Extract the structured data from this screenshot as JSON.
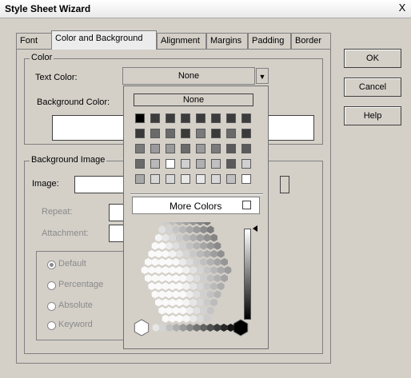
{
  "window": {
    "title": "Style Sheet Wizard",
    "close_glyph": "X"
  },
  "tabs": [
    {
      "label": "Font"
    },
    {
      "label": "Color and Background"
    },
    {
      "label": "Alignment"
    },
    {
      "label": "Margins"
    },
    {
      "label": "Padding"
    },
    {
      "label": "Border"
    }
  ],
  "buttons": {
    "ok": "OK",
    "cancel": "Cancel",
    "help": "Help"
  },
  "color_group": {
    "legend": "Color",
    "text_color_label": "Text Color:",
    "text_color_value": "None",
    "background_color_label": "Background Color:"
  },
  "bg_image_group": {
    "legend": "Background Image",
    "image_label": "Image:",
    "repeat_label": "Repeat:",
    "attachment_label": "Attachment:",
    "position_options": [
      "Default",
      "Percentage",
      "Absolute",
      "Keyword"
    ],
    "selected_position": "Default"
  },
  "color_picker": {
    "none_label": "None",
    "more_colors_label": "More Colors",
    "swatch_rows": [
      [
        "#000000",
        "#3c3c3c",
        "#3c3c3c",
        "#3c3c3c",
        "#3c3c3c",
        "#3c3c3c",
        "#3c3c3c",
        "#3c3c3c"
      ],
      [
        "#3a3a3a",
        "#6a6a6a",
        "#6a6a6a",
        "#3a3a3a",
        "#7a7a7a",
        "#3a3a3a",
        "#6a6a6a",
        "#3a3a3a"
      ],
      [
        "#7a7a7a",
        "#9a9a9a",
        "#9a9a9a",
        "#6a6a6a",
        "#9a9a9a",
        "#7a7a7a",
        "#5a5a5a",
        "#5a5a5a"
      ],
      [
        "#6a6a6a",
        "#b8b8b8",
        "#ffffff",
        "#d0d0d0",
        "#b0b0b0",
        "#c0c0c0",
        "#5a5a5a",
        "#d0d0d0"
      ],
      [
        "#a8a8a8",
        "#d8d8d8",
        "#d8d8d8",
        "#e8e8e8",
        "#e8e8e8",
        "#d8d8d8",
        "#c0c0c0",
        "#ffffff"
      ]
    ]
  }
}
